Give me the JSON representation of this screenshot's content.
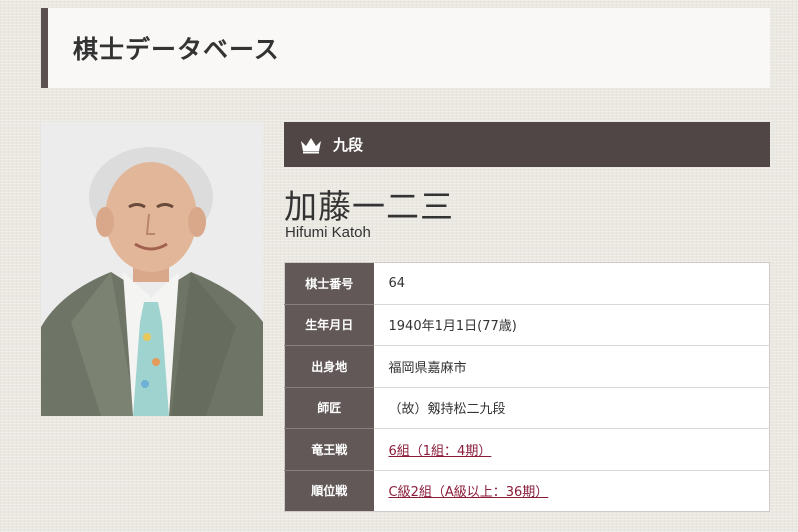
{
  "header": {
    "title": "棋士データベース"
  },
  "profile": {
    "rank": "九段",
    "name_jp": "加藤一二三",
    "name_en": "Hifumi Katoh",
    "photo_icon": "portrait-photo",
    "rank_icon": "crown-icon"
  },
  "details": [
    {
      "label": "棋士番号",
      "value": "64",
      "link": false
    },
    {
      "label": "生年月日",
      "value": "1940年1月1日(77歳)",
      "link": false
    },
    {
      "label": "出身地",
      "value": "福岡県嘉麻市",
      "link": false
    },
    {
      "label": "師匠",
      "value": "（故）剱持松二九段",
      "link": false
    },
    {
      "label": "竜王戦",
      "value": "6組（1組：4期）",
      "link": true
    },
    {
      "label": "順位戦",
      "value": "C級2組（A級以上：36期）",
      "link": true
    }
  ],
  "colors": {
    "header_border": "#5b5150",
    "rank_bar": "#4f4645",
    "table_header": "#615857",
    "link": "#8a1c3a"
  }
}
